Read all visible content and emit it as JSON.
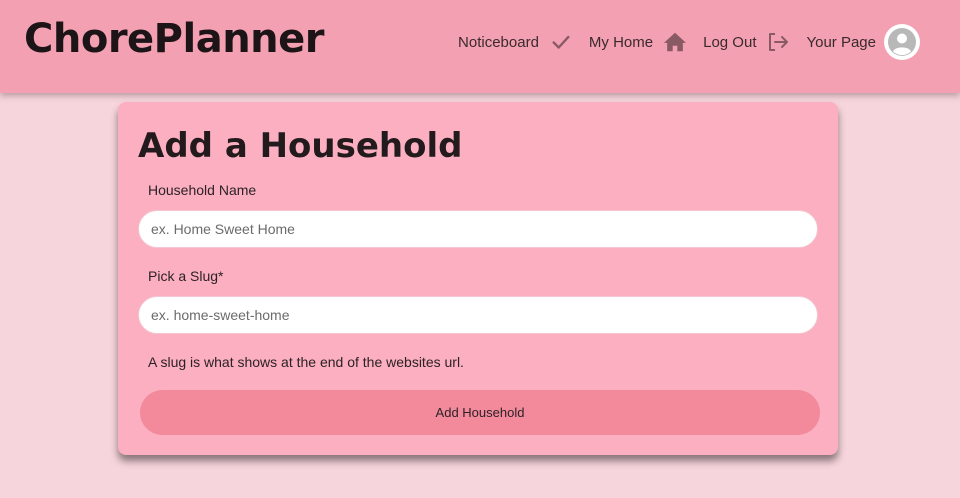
{
  "header": {
    "brand": "ChorePlanner",
    "nav": [
      {
        "label": "Noticeboard",
        "icon": "check-icon"
      },
      {
        "label": "My Home",
        "icon": "home-icon"
      },
      {
        "label": "Log Out",
        "icon": "logout-icon"
      },
      {
        "label": "Your Page",
        "icon": "avatar-icon"
      }
    ]
  },
  "form": {
    "title": "Add a Household",
    "household_name": {
      "label": "Household Name",
      "placeholder": "ex. Home Sweet Home",
      "value": ""
    },
    "slug": {
      "label": "Pick a Slug*",
      "placeholder": "ex. home-sweet-home",
      "value": ""
    },
    "help": "A slug is what shows at the end of the websites url.",
    "submit_label": "Add Household"
  },
  "colors": {
    "header_bg": "#f3a0b2",
    "page_bg": "#f7d5dc",
    "card_bg": "#fbafc0",
    "button_bg": "#f28a9c",
    "icon": "#8a5a64"
  }
}
